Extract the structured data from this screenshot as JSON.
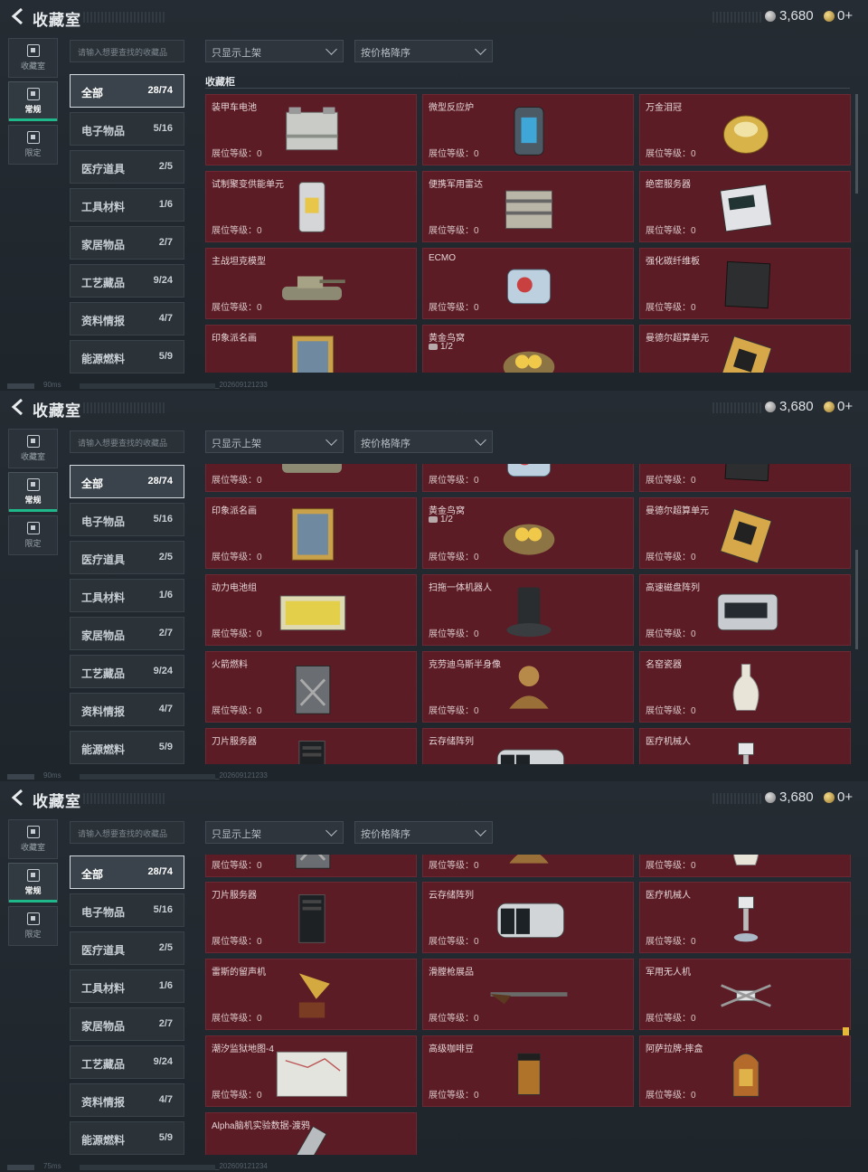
{
  "header": {
    "title": "收藏室",
    "silver_amount": "3,680",
    "gold_amount": "0+"
  },
  "sidebar": {
    "tabs": [
      {
        "label": "收藏室",
        "icon": "collection-icon",
        "active": false
      },
      {
        "label": "常规",
        "icon": "regular-icon",
        "active": true
      },
      {
        "label": "限定",
        "icon": "limited-icon",
        "active": false
      }
    ]
  },
  "search": {
    "placeholder": "请输入想要查找的收藏品"
  },
  "filters": {
    "shelf_filter": "只显示上架",
    "sort": "按价格降序"
  },
  "categories": [
    {
      "label": "全部",
      "count": "28/74",
      "active": true
    },
    {
      "label": "电子物品",
      "count": "5/16"
    },
    {
      "label": "医疗道具",
      "count": "2/5"
    },
    {
      "label": "工具材料",
      "count": "1/6"
    },
    {
      "label": "家居物品",
      "count": "2/7"
    },
    {
      "label": "工艺藏品",
      "count": "9/24"
    },
    {
      "label": "资料情报",
      "count": "4/7"
    },
    {
      "label": "能源燃料",
      "count": "5/9"
    }
  ],
  "section_title": "收藏柜",
  "level_label": "展位等级：0",
  "items": [
    {
      "name": "装甲车电池",
      "icon": "battery-icon"
    },
    {
      "name": "微型反应炉",
      "icon": "reactor-icon"
    },
    {
      "name": "万金泪冠",
      "icon": "crown-icon"
    },
    {
      "name": "试制聚变供能单元",
      "icon": "fusion-cell-icon"
    },
    {
      "name": "便携军用雷达",
      "icon": "radar-icon"
    },
    {
      "name": "绝密服务器",
      "icon": "server-icon"
    },
    {
      "name": "主战坦克模型",
      "icon": "tank-icon"
    },
    {
      "name": "ECMO",
      "icon": "ecmo-icon"
    },
    {
      "name": "强化碳纤维板",
      "icon": "carbon-plate-icon"
    },
    {
      "name": "印象派名画",
      "icon": "painting-icon"
    },
    {
      "name": "黄金鸟窝",
      "icon": "golden-nest-icon",
      "count": "1/2"
    },
    {
      "name": "曼德尔超算单元",
      "icon": "supercomputer-icon"
    },
    {
      "name": "动力电池组",
      "icon": "battery-pack-icon"
    },
    {
      "name": "扫拖一体机器人",
      "icon": "robot-vacuum-icon"
    },
    {
      "name": "高速磁盘阵列",
      "icon": "disk-array-icon"
    },
    {
      "name": "火箭燃料",
      "icon": "fuel-can-icon"
    },
    {
      "name": "克劳迪乌斯半身像",
      "icon": "bust-icon"
    },
    {
      "name": "名窑瓷器",
      "icon": "vase-icon"
    },
    {
      "name": "刀片服务器",
      "icon": "blade-server-icon"
    },
    {
      "name": "云存储阵列",
      "icon": "cloud-storage-icon"
    },
    {
      "name": "医疗机械人",
      "icon": "medical-robot-icon"
    },
    {
      "name": "雷斯的留声机",
      "icon": "gramophone-icon"
    },
    {
      "name": "滑膛枪展品",
      "icon": "musket-icon"
    },
    {
      "name": "军用无人机",
      "icon": "drone-icon"
    },
    {
      "name": "潮汐监狱地图-4",
      "icon": "map-icon"
    },
    {
      "name": "高级咖啡豆",
      "icon": "coffee-icon"
    },
    {
      "name": "阿萨拉牌-摔盒",
      "icon": "jukebox-icon"
    },
    {
      "name": "Alpha脑机实验数据-渡鸦",
      "icon": "data-canister-icon"
    }
  ],
  "footer": [
    {
      "ping": "90ms",
      "build": "_202609121233"
    },
    {
      "ping": "90ms",
      "build": "_202609121233"
    },
    {
      "ping": "75ms",
      "build": "_202609121234"
    }
  ]
}
